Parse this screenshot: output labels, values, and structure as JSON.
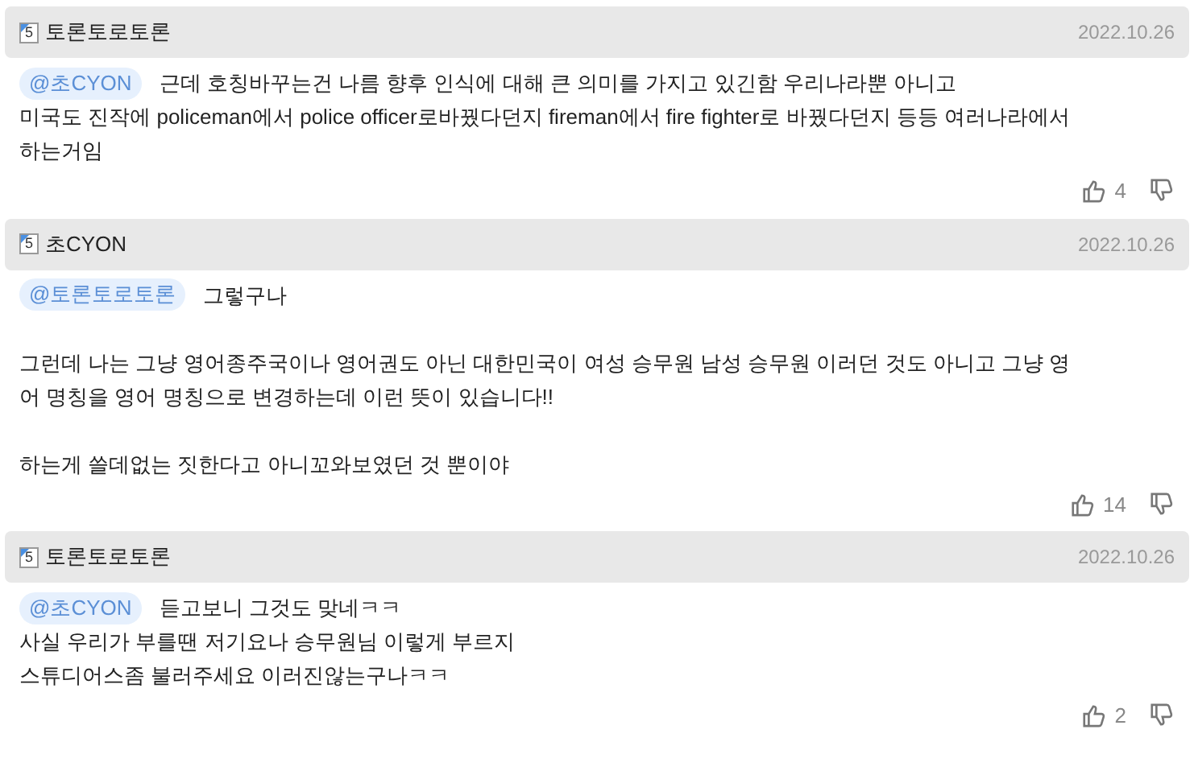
{
  "comments": [
    {
      "level": "5",
      "author": "토론토로토론",
      "date": "2022.10.26",
      "mention": "@초CYON",
      "paragraphs": [
        [
          "근데 호칭바꾸는건 나름 향후 인식에 대해 큰 의미를 가지고 있긴함 우리나라뿐 아니고",
          "미국도 진작에 policeman에서 police officer로바꿨다던지 fireman에서 fire fighter로 바꿨다던지 등등 여러나라에서",
          "하는거임"
        ]
      ],
      "likes": "4"
    },
    {
      "level": "5",
      "author": "초CYON",
      "date": "2022.10.26",
      "mention": "@토론토로토론",
      "paragraphs": [
        [
          "그렇구나"
        ],
        [
          "그런데 나는 그냥 영어종주국이나 영어권도 아닌 대한민국이 여성 승무원 남성 승무원 이러던 것도 아니고 그냥 영",
          "어 명칭을 영어 명칭으로 변경하는데 이런 뜻이 있습니다!!"
        ],
        [
          "하는게 쓸데없는 짓한다고 아니꼬와보였던 것 뿐이야"
        ]
      ],
      "likes": "14"
    },
    {
      "level": "5",
      "author": "토론토로토론",
      "date": "2022.10.26",
      "mention": "@초CYON",
      "paragraphs": [
        [
          "듣고보니 그것도 맞네ㅋㅋ",
          "사실 우리가 부를땐 저기요나 승무원님 이렇게 부르지",
          "스튜디어스좀 불러주세요 이러진않는구나ㅋㅋ"
        ]
      ],
      "likes": "2"
    }
  ]
}
